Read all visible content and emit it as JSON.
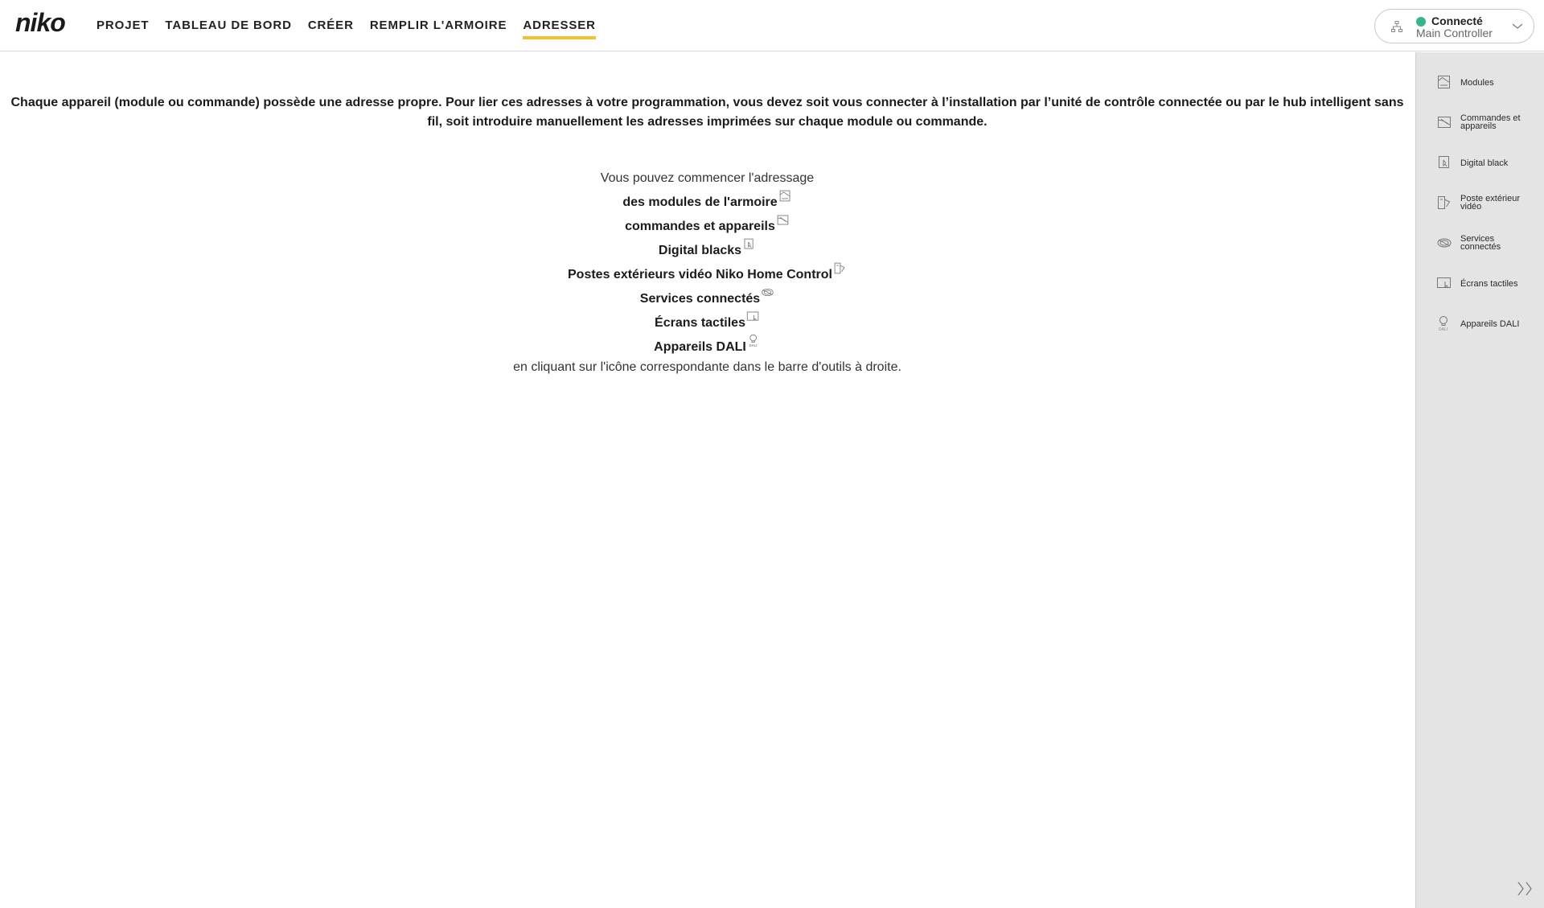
{
  "header": {
    "logo_text": "niko",
    "nav": [
      {
        "label": "PROJET",
        "active": false
      },
      {
        "label": "TABLEAU DE BORD",
        "active": false
      },
      {
        "label": "CRÉER",
        "active": false
      },
      {
        "label": "REMPLIR L'ARMOIRE",
        "active": false
      },
      {
        "label": "ADRESSER",
        "active": true
      }
    ],
    "connection": {
      "status": "Connecté",
      "controller": "Main Controller",
      "status_color": "#36b58d",
      "icon": "network-icon"
    },
    "accent_color": "#f2c12e"
  },
  "main": {
    "intro": "Chaque appareil (module ou commande) possède une adresse propre. Pour lier ces adresses à votre programmation, vous devez soit vous connecter à l’installation par l’unité de contrôle connectée ou par le hub intelligent sans fil, soit introduire manuellement les adresses imprimées sur chaque module ou commande.",
    "start_text": "Vous pouvez commencer l'adressage",
    "items": [
      {
        "label": "des modules de l'armoire",
        "icon": "modules-icon"
      },
      {
        "label": "commandes et appareils",
        "icon": "controls-devices-icon"
      },
      {
        "label": "Digital blacks",
        "icon": "digital-black-icon"
      },
      {
        "label": "Postes extérieurs vidéo Niko Home Control",
        "icon": "video-outdoor-station-icon"
      },
      {
        "label": "Services connectés",
        "icon": "connected-services-icon"
      },
      {
        "label": "Écrans tactiles",
        "icon": "touchscreen-icon"
      },
      {
        "label": "Appareils DALI",
        "icon": "dali-icon"
      }
    ],
    "end_text": "en cliquant sur l'icône correspondante dans le barre d'outils à droite."
  },
  "toolbar": {
    "items": [
      {
        "label": "Modules",
        "icon": "modules-icon"
      },
      {
        "label": "Commandes et appareils",
        "icon": "controls-devices-icon"
      },
      {
        "label": "Digital black",
        "icon": "digital-black-icon"
      },
      {
        "label": "Poste extérieur vidéo",
        "icon": "video-outdoor-station-icon"
      },
      {
        "label": "Services connectés",
        "icon": "connected-services-icon"
      },
      {
        "label": "Écrans tactiles",
        "icon": "touchscreen-icon"
      },
      {
        "label": "Appareils DALI",
        "icon": "dali-icon"
      }
    ],
    "expand_icon": "double-chevron-right-icon"
  }
}
